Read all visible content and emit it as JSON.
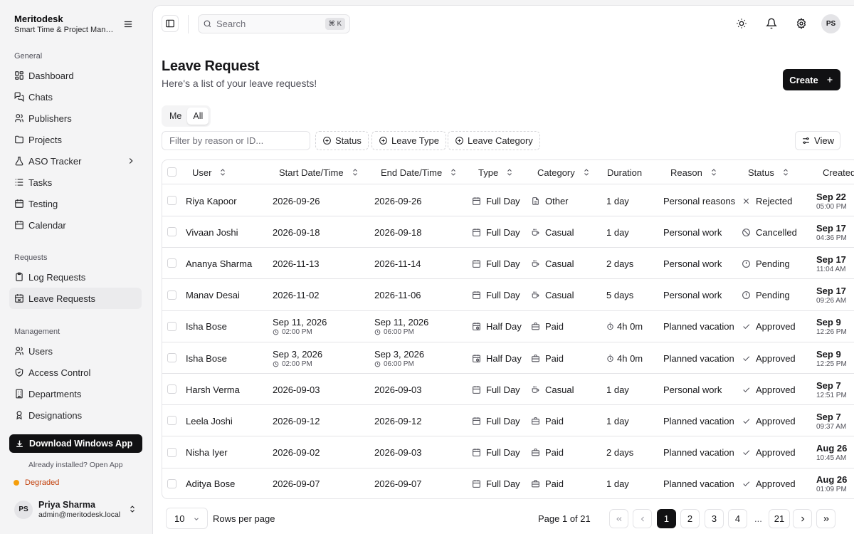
{
  "app": {
    "name": "Meritodesk",
    "subtitle": "Smart Time & Project Management"
  },
  "sidebar": {
    "groups": [
      {
        "label": "General"
      },
      {
        "label": "Requests"
      },
      {
        "label": "Management"
      }
    ],
    "items": [
      {
        "label": "Dashboard",
        "icon": "dashboard-icon"
      },
      {
        "label": "Chats",
        "icon": "chat-icon"
      },
      {
        "label": "Publishers",
        "icon": "users-icon"
      },
      {
        "label": "Projects",
        "icon": "folder-icon"
      },
      {
        "label": "ASO Tracker",
        "icon": "flask-icon"
      },
      {
        "label": "Tasks",
        "icon": "list-icon"
      },
      {
        "label": "Testing",
        "icon": "calendar-icon"
      },
      {
        "label": "Calendar",
        "icon": "calendar-icon"
      },
      {
        "label": "Log Requests",
        "icon": "clipboard-icon"
      },
      {
        "label": "Leave Requests",
        "icon": "calendar-off-icon"
      },
      {
        "label": "Users",
        "icon": "users-icon"
      },
      {
        "label": "Access Control",
        "icon": "shield-icon"
      },
      {
        "label": "Departments",
        "icon": "building-icon"
      },
      {
        "label": "Designations",
        "icon": "badge-icon"
      }
    ],
    "download_label": "Download Windows App",
    "installed_text": "Already installed? Open App",
    "status_text": "Degraded",
    "user": {
      "initials": "PS",
      "name": "Priya Sharma",
      "email": "admin@meritodesk.local"
    }
  },
  "topbar": {
    "search_placeholder": "Search",
    "shortcut": "⌘ K",
    "avatar_initials": "PS",
    "icons": [
      "sidebar-toggle-icon",
      "sun-icon",
      "bell-icon",
      "gear-icon"
    ]
  },
  "page": {
    "title": "Leave Request",
    "subtitle": "Here's a list of your leave requests!",
    "create_label": "Create",
    "tabs": [
      {
        "label": "Me"
      },
      {
        "label": "All",
        "selected": true
      }
    ],
    "filter_placeholder": "Filter by reason or ID...",
    "filters": [
      {
        "label": "Status"
      },
      {
        "label": "Leave Type"
      },
      {
        "label": "Leave Category"
      }
    ],
    "view_label": "View"
  },
  "table": {
    "headers": {
      "user": "User",
      "start": "Start Date/Time",
      "end": "End Date/Time",
      "type": "Type",
      "category": "Category",
      "duration": "Duration",
      "reason": "Reason",
      "status": "Status",
      "created": "Created"
    },
    "rows": [
      {
        "user": "Riya Kapoor",
        "start": "2026-09-26",
        "start_time": "",
        "end": "2026-09-26",
        "end_time": "",
        "type": "Full Day",
        "category": "Other",
        "duration": "1 day",
        "reason": "Personal reasons",
        "status": "Rejected",
        "created": "Sep 22",
        "created_time": "05:00 PM"
      },
      {
        "user": "Vivaan Joshi",
        "start": "2026-09-18",
        "start_time": "",
        "end": "2026-09-18",
        "end_time": "",
        "type": "Full Day",
        "category": "Casual",
        "duration": "1 day",
        "reason": "Personal work",
        "status": "Cancelled",
        "created": "Sep 17",
        "created_time": "04:36 PM"
      },
      {
        "user": "Ananya Sharma",
        "start": "2026-11-13",
        "start_time": "",
        "end": "2026-11-14",
        "end_time": "",
        "type": "Full Day",
        "category": "Casual",
        "duration": "2 days",
        "reason": "Personal work",
        "status": "Pending",
        "created": "Sep 17",
        "created_time": "11:04 AM"
      },
      {
        "user": "Manav Desai",
        "start": "2026-11-02",
        "start_time": "",
        "end": "2026-11-06",
        "end_time": "",
        "type": "Full Day",
        "category": "Casual",
        "duration": "5 days",
        "reason": "Personal work",
        "status": "Pending",
        "created": "Sep 17",
        "created_time": "09:26 AM"
      },
      {
        "user": "Isha Bose",
        "start": "Sep 11, 2026",
        "start_time": "02:00 PM",
        "end": "Sep 11, 2026",
        "end_time": "06:00 PM",
        "type": "Half Day",
        "category": "Paid",
        "duration": "4h 0m",
        "reason": "Planned vacation",
        "status": "Approved",
        "created": "Sep 9",
        "created_time": "12:26 PM"
      },
      {
        "user": "Isha Bose",
        "start": "Sep 3, 2026",
        "start_time": "02:00 PM",
        "end": "Sep 3, 2026",
        "end_time": "06:00 PM",
        "type": "Half Day",
        "category": "Paid",
        "duration": "4h 0m",
        "reason": "Planned vacation",
        "status": "Approved",
        "created": "Sep 9",
        "created_time": "12:25 PM"
      },
      {
        "user": "Harsh Verma",
        "start": "2026-09-03",
        "start_time": "",
        "end": "2026-09-03",
        "end_time": "",
        "type": "Full Day",
        "category": "Casual",
        "duration": "1 day",
        "reason": "Personal work",
        "status": "Approved",
        "created": "Sep 7",
        "created_time": "12:51 PM"
      },
      {
        "user": "Leela Joshi",
        "start": "2026-09-12",
        "start_time": "",
        "end": "2026-09-12",
        "end_time": "",
        "type": "Full Day",
        "category": "Paid",
        "duration": "1 day",
        "reason": "Planned vacation",
        "status": "Approved",
        "created": "Sep 7",
        "created_time": "09:37 AM"
      },
      {
        "user": "Nisha Iyer",
        "start": "2026-09-02",
        "start_time": "",
        "end": "2026-09-03",
        "end_time": "",
        "type": "Full Day",
        "category": "Paid",
        "duration": "2 days",
        "reason": "Planned vacation",
        "status": "Approved",
        "created": "Aug 26",
        "created_time": "10:45 AM"
      },
      {
        "user": "Aditya Bose",
        "start": "2026-09-07",
        "start_time": "",
        "end": "2026-09-07",
        "end_time": "",
        "type": "Full Day",
        "category": "Paid",
        "duration": "1 day",
        "reason": "Planned vacation",
        "status": "Approved",
        "created": "Aug 26",
        "created_time": "01:09 PM"
      }
    ]
  },
  "pagination": {
    "rows_per_page": "10",
    "rows_label": "Rows per page",
    "page_info": "Page 1 of 21",
    "pages": [
      "1",
      "2",
      "3",
      "4"
    ],
    "ellipsis": "...",
    "last_page": "21",
    "current_page": "1"
  }
}
